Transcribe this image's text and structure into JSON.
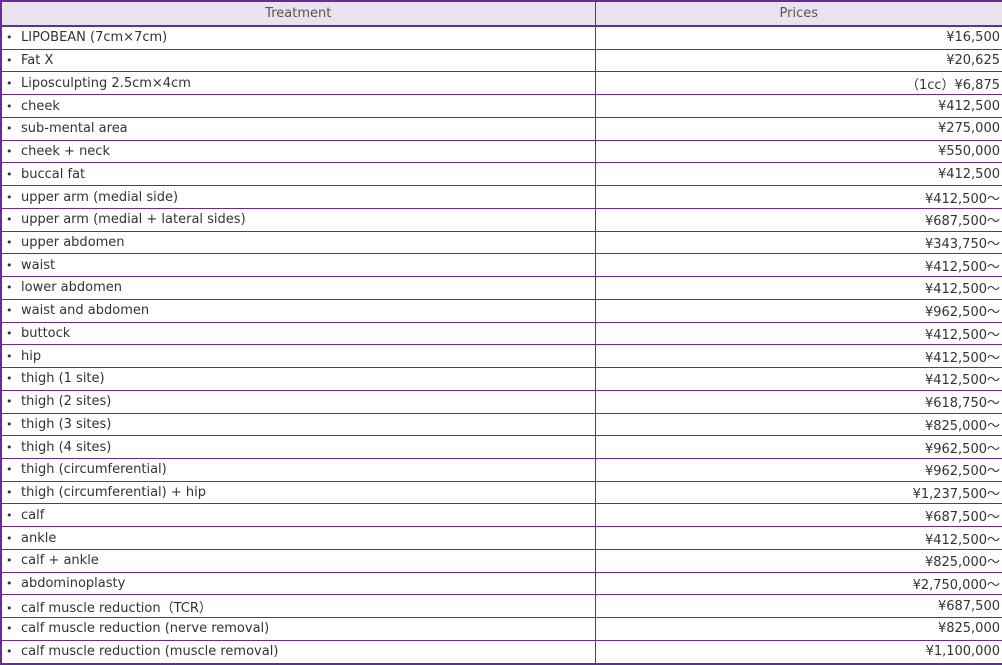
{
  "table": {
    "headers": {
      "treatment": "Treatment",
      "prices": "Prices"
    },
    "bullet": "•",
    "rows": [
      {
        "treatment": "LIPOBEAN (7cm×7cm)",
        "price": "¥16,500"
      },
      {
        "treatment": "Fat X",
        "price": "¥20,625"
      },
      {
        "treatment": "Liposculpting 2.5cm×4cm",
        "price": "（1cc）¥6,875"
      },
      {
        "treatment": "cheek",
        "price": "¥412,500"
      },
      {
        "treatment": "sub-mental area",
        "price": "¥275,000"
      },
      {
        "treatment": "cheek + neck",
        "price": "¥550,000"
      },
      {
        "treatment": "buccal fat",
        "price": "¥412,500"
      },
      {
        "treatment": "upper arm (medial side)",
        "price": "¥412,500～"
      },
      {
        "treatment": "upper arm (medial + lateral sides)",
        "price": "¥687,500～"
      },
      {
        "treatment": "upper abdomen",
        "price": "¥343,750～"
      },
      {
        "treatment": "waist",
        "price": "¥412,500～"
      },
      {
        "treatment": "lower abdomen",
        "price": "¥412,500～"
      },
      {
        "treatment": "waist and abdomen",
        "price": "¥962,500～"
      },
      {
        "treatment": "buttock",
        "price": "¥412,500～"
      },
      {
        "treatment": "hip",
        "price": "¥412,500～"
      },
      {
        "treatment": "thigh (1 site)",
        "price": "¥412,500～"
      },
      {
        "treatment": "thigh (2 sites)",
        "price": "¥618,750～"
      },
      {
        "treatment": "thigh (3 sites)",
        "price": "¥825,000～"
      },
      {
        "treatment": "thigh (4 sites)",
        "price": "¥962,500～"
      },
      {
        "treatment": "thigh (circumferential)",
        "price": "¥962,500～"
      },
      {
        "treatment": "thigh (circumferential) + hip",
        "price": "¥1,237,500～"
      },
      {
        "treatment": "calf",
        "price": "¥687,500～"
      },
      {
        "treatment": "ankle",
        "price": "¥412,500～"
      },
      {
        "treatment": "calf + ankle",
        "price": "¥825,000～"
      },
      {
        "treatment": "abdominoplasty",
        "price": "¥2,750,000～"
      },
      {
        "treatment": "calf muscle reduction（TCR）",
        "price": "¥687,500"
      },
      {
        "treatment": "calf muscle reduction (nerve removal)",
        "price": "¥825,000"
      },
      {
        "treatment": "calf muscle reduction (muscle removal)",
        "price": "¥1,100,000"
      }
    ]
  },
  "colors": {
    "border": "#6a2a9a",
    "header_bg": "#e9e3ee",
    "text": "#333333"
  }
}
